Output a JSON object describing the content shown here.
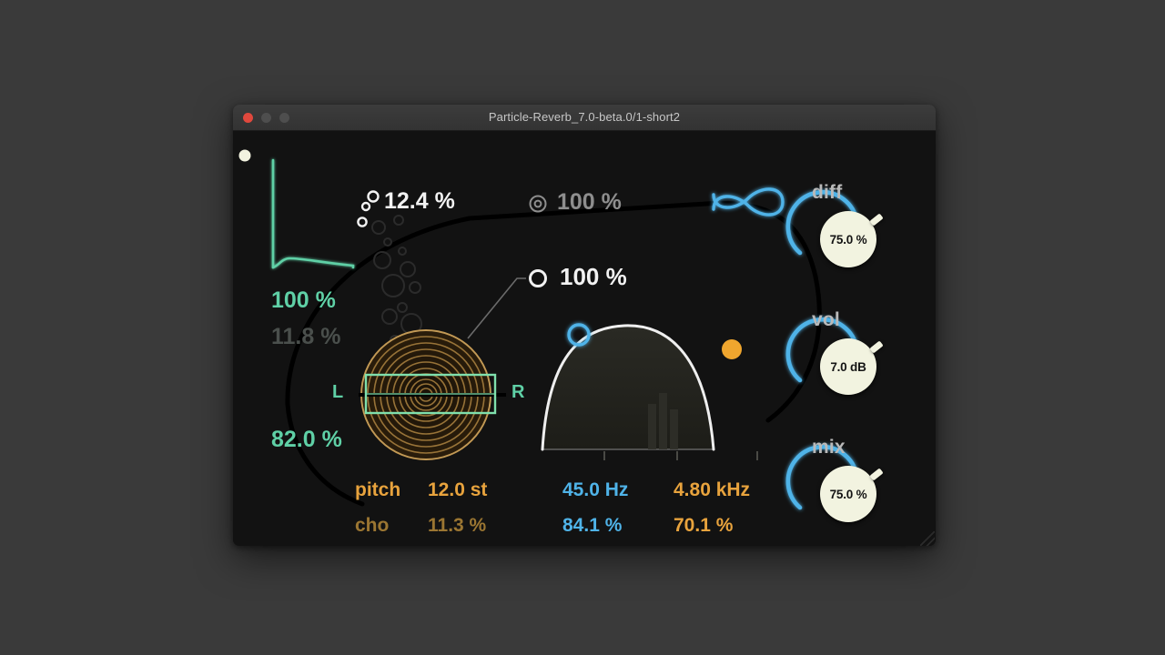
{
  "window": {
    "title": "Particle-Reverb_7.0-beta.0/1-short2",
    "controls": [
      {
        "name": "close",
        "color": "#e0483d"
      },
      {
        "name": "minimize",
        "color": "#4e4e4e"
      },
      {
        "name": "maximize",
        "color": "#4e4e4e"
      }
    ]
  },
  "colors": {
    "desktop_bg": "#3a3a3a",
    "plugin_bg": "#121212",
    "titlebar_bg": "#363636",
    "teal": "#5fd0a6",
    "teal_dim": "#4a4f4c",
    "white": "#f2f2f2",
    "grey": "#8e8e8e",
    "blue": "#4fb3e8",
    "orange": "#e8a33d",
    "orange_dim": "#9b7632",
    "knob_face": "#f2f3e0",
    "knob_text": "#141414"
  },
  "decay_panel": {
    "curve_label": "decay-envelope-curve",
    "values": [
      {
        "name": "decay-amount",
        "text": "100 %",
        "style": "teal"
      },
      {
        "name": "decay-secondary",
        "text": "11.8 %",
        "style": "dim"
      },
      {
        "name": "stereo-width",
        "text": "82.0 %",
        "style": "teal"
      }
    ]
  },
  "stereo_field": {
    "left_label": "L",
    "right_label": "R"
  },
  "particle_readouts": [
    {
      "name": "particle-density",
      "icon": "two-rings-icon",
      "text": "12.4 %",
      "style": "white"
    },
    {
      "name": "particle-spread",
      "icon": "target-icon",
      "text": "100 %",
      "style": "grey"
    },
    {
      "name": "particle-size",
      "icon": "ring-icon",
      "text": "100 %",
      "style": "white"
    }
  ],
  "freeze": {
    "name": "infinity-freeze-icon",
    "symbol": "∞"
  },
  "bottom_params": [
    {
      "name": "pitch-label",
      "text": "pitch",
      "style": "orange"
    },
    {
      "name": "pitch-value",
      "text": "12.0 st",
      "style": "orange"
    },
    {
      "name": "cho-label",
      "text": "cho",
      "style": "orange-dim"
    },
    {
      "name": "cho-value",
      "text": "11.3 %",
      "style": "orange-dim"
    },
    {
      "name": "filter-low-freq",
      "text": "45.0 Hz",
      "style": "blue"
    },
    {
      "name": "filter-low-amount",
      "text": "84.1 %",
      "style": "blue"
    },
    {
      "name": "filter-high-freq",
      "text": "4.80 kHz",
      "style": "orange"
    },
    {
      "name": "filter-high-amount",
      "text": "70.1 %",
      "style": "orange"
    }
  ],
  "knobs": [
    {
      "name": "diff",
      "label": "diff",
      "value": "75.0 %",
      "arc_pct": 75
    },
    {
      "name": "vol",
      "label": "vol",
      "value": "7.0 dB",
      "arc_pct": 75
    },
    {
      "name": "mix",
      "label": "mix",
      "value": "75.0 %",
      "arc_pct": 75
    }
  ],
  "indicator": {
    "name": "power-indicator",
    "state": "on"
  }
}
